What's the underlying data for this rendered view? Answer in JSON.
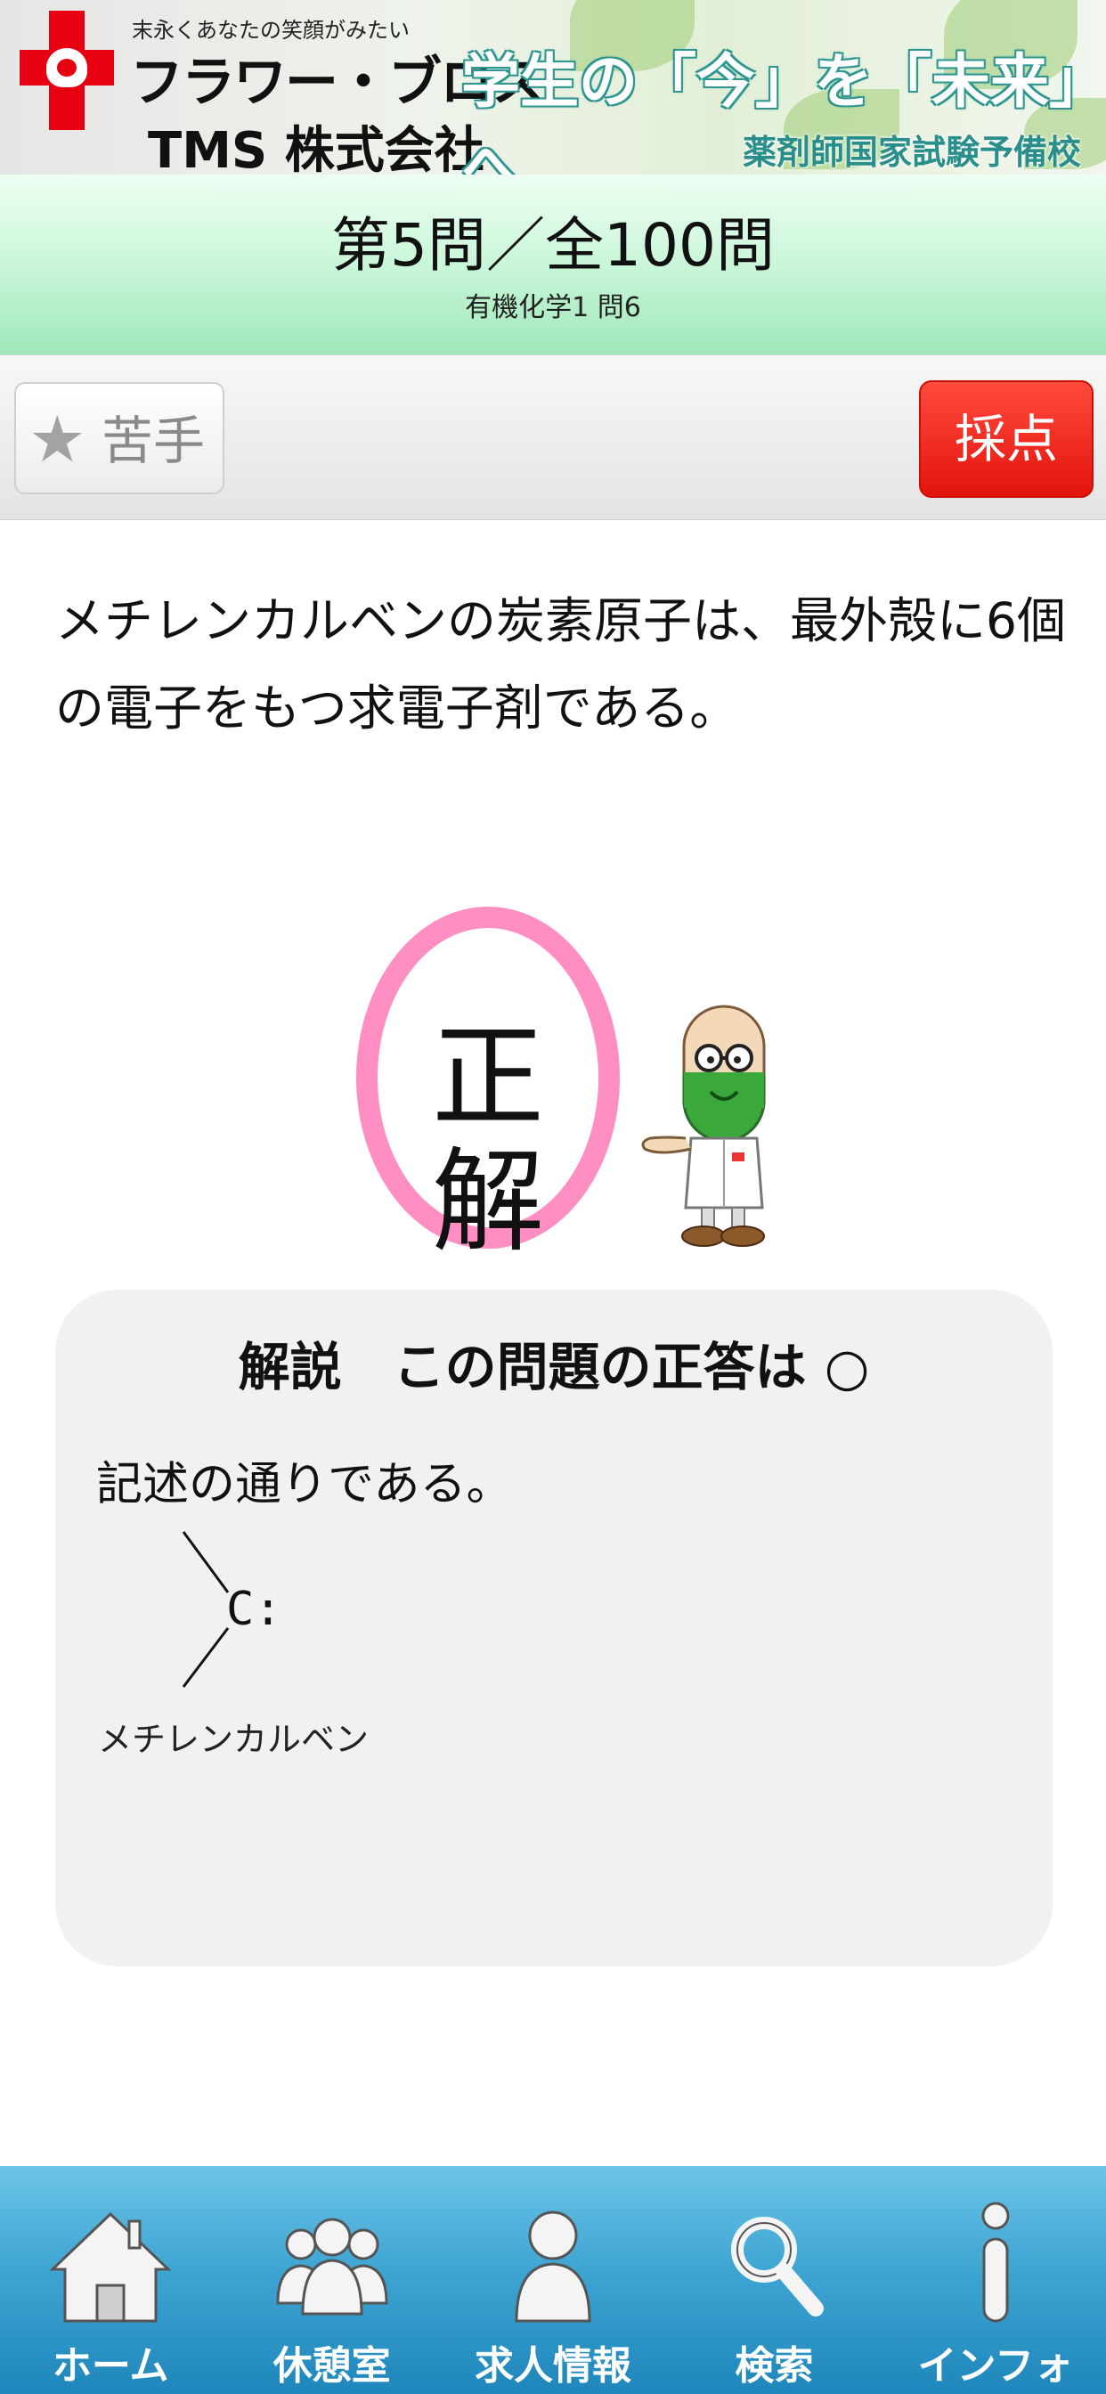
{
  "banner": {
    "tagline": "末永くあなたの笑顔がみたい",
    "company_line1": "フラワー・ブロス",
    "company_line2": "TMS 株式会社",
    "slogan": "学生の「今」を「未来」へ",
    "school": "薬剤師国家試験予備校"
  },
  "question": {
    "counter": "第5問／全100問",
    "category": "有機化学1 問6",
    "text": "メチレンカルベンの炭素原子は、最外殻に6個の電子をもつ求電子剤である。"
  },
  "toolbar": {
    "weak_label": "苦手",
    "grade_label": "採点"
  },
  "result": {
    "label": "正解"
  },
  "explanation": {
    "title": "解説　この問題の正答は ○",
    "body": "記述の通りである。",
    "structure_atom": "C:",
    "structure_caption": "メチレンカルベン"
  },
  "tabs": [
    {
      "label": "ホーム",
      "icon": "home-icon"
    },
    {
      "label": "休憩室",
      "icon": "people-icon"
    },
    {
      "label": "求人情報",
      "icon": "person-icon"
    },
    {
      "label": "検索",
      "icon": "search-icon"
    },
    {
      "label": "インフォ",
      "icon": "info-icon"
    }
  ],
  "colors": {
    "grade_button": "#e3140c",
    "result_ring": "#ff8fc3",
    "tabbar": "#3fa5d3",
    "header": "#c6f5d6"
  }
}
